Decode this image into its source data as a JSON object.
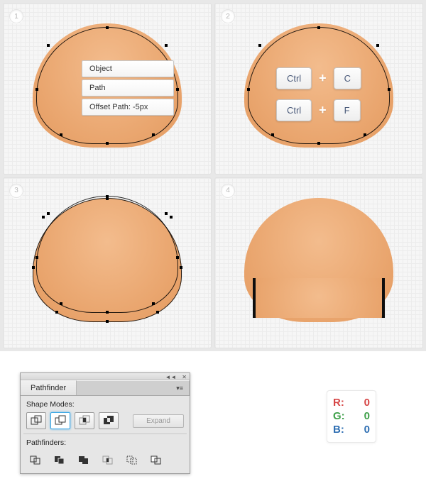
{
  "steps": {
    "s1": "1",
    "s2": "2",
    "s3": "3",
    "s4": "4"
  },
  "menu": {
    "item1": "Object",
    "item2": "Path",
    "item3": "Offset Path: -5px"
  },
  "shortcuts": {
    "row1": {
      "mod": "Ctrl",
      "key": "C"
    },
    "row2": {
      "mod": "Ctrl",
      "key": "F"
    },
    "plus": "+"
  },
  "pathfinder": {
    "title": "Pathfinder",
    "shape_modes_label": "Shape Modes:",
    "pathfinders_label": "Pathfinders:",
    "expand_label": "Expand"
  },
  "rgb": {
    "r_label": "R:",
    "r_value": "0",
    "g_label": "G:",
    "g_value": "0",
    "b_label": "B:",
    "b_value": "0"
  }
}
